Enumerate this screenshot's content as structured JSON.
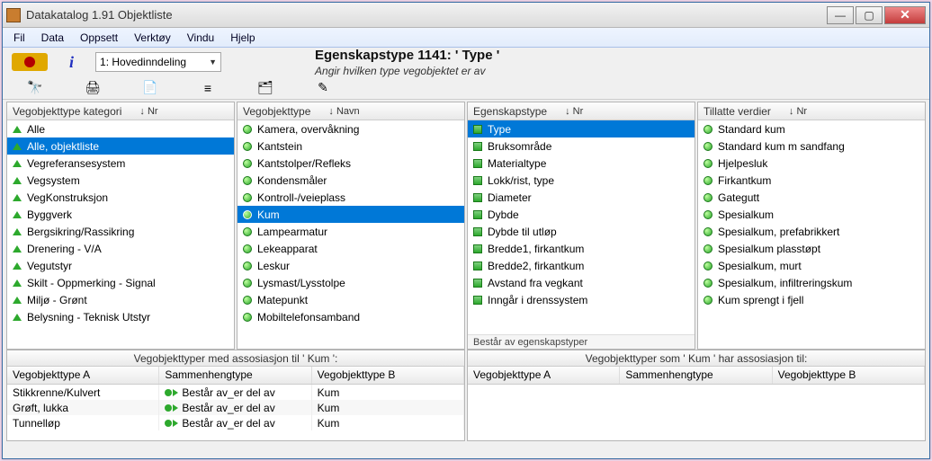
{
  "window": {
    "title": "Datakatalog 1.91  Objektliste"
  },
  "menu": [
    "Fil",
    "Data",
    "Oppsett",
    "Verktøy",
    "Vindu",
    "Hjelp"
  ],
  "toolbar": {
    "combo": "1: Hovedinndeling",
    "header_title": "Egenskapstype 1141:  ' Type '",
    "header_sub": "Angir hvilken type vegobjektet er av"
  },
  "iconbar_names": [
    "binoculars",
    "print",
    "new-doc",
    "align",
    "tree",
    "pencil"
  ],
  "panels": {
    "category": {
      "header": "Vegobjekttype kategori",
      "sort": "↓ Nr",
      "items": [
        "Alle",
        "Alle, objektliste",
        "Vegreferansesystem",
        "Vegsystem",
        "VegKonstruksjon",
        "Byggverk",
        "Bergsikring/Rassikring",
        "Drenering - V/A",
        "Vegutstyr",
        "Skilt - Oppmerking - Signal",
        "Miljø - Grønt",
        "Belysning - Teknisk Utstyr"
      ],
      "selected": 1
    },
    "objtype": {
      "header": "Vegobjekttype",
      "sort": "↓ Navn",
      "items": [
        "Kamera, overvåkning",
        "Kantstein",
        "Kantstolper/Refleks",
        "Kondensmåler",
        "Kontroll-/veieplass",
        "Kum",
        "Lampearmatur",
        "Lekeapparat",
        "Leskur",
        "Lysmast/Lysstolpe",
        "Matepunkt",
        "Mobiltelefonsamband"
      ],
      "selected": 5
    },
    "prop": {
      "header": "Egenskapstype",
      "sort": "↓ Nr",
      "items": [
        "Type",
        "Bruksområde",
        "Materialtype",
        "Lokk/rist, type",
        "Diameter",
        "Dybde",
        "Dybde til utløp",
        "Bredde1, firkantkum",
        "Bredde2, firkantkum",
        "Avstand fra vegkant",
        "Inngår i drenssystem"
      ],
      "selected": 0,
      "status": "Består av egenskapstyper"
    },
    "allowed": {
      "header": "Tillatte verdier",
      "sort": "↓ Nr",
      "items": [
        "Standard kum",
        "Standard kum m sandfang",
        "Hjelpesluk",
        "Firkantkum",
        "Gategutt",
        "Spesialkum",
        "Spesialkum, prefabrikkert",
        "Spesialkum plasstøpt",
        "Spesialkum, murt",
        "Spesialkum, infiltreringskum",
        "Kum sprengt i fjell"
      ],
      "selected": -1
    }
  },
  "bottom": {
    "left": {
      "title": "Vegobjekttyper med assosiasjon til ' Kum ':",
      "cols": [
        "Vegobjekttype A",
        "Sammenhengtype",
        "Vegobjekttype B"
      ],
      "rows": [
        [
          "Stikkrenne/Kulvert",
          "Består av_er del av",
          "Kum"
        ],
        [
          "Grøft, lukka",
          "Består av_er del av",
          "Kum"
        ],
        [
          "Tunnelløp",
          "Består av_er del av",
          "Kum"
        ]
      ]
    },
    "right": {
      "title": "Vegobjekttyper som ' Kum ' har assosiasjon til:",
      "cols": [
        "Vegobjekttype A",
        "Sammenhengtype",
        "Vegobjekttype B"
      ],
      "rows": []
    }
  }
}
